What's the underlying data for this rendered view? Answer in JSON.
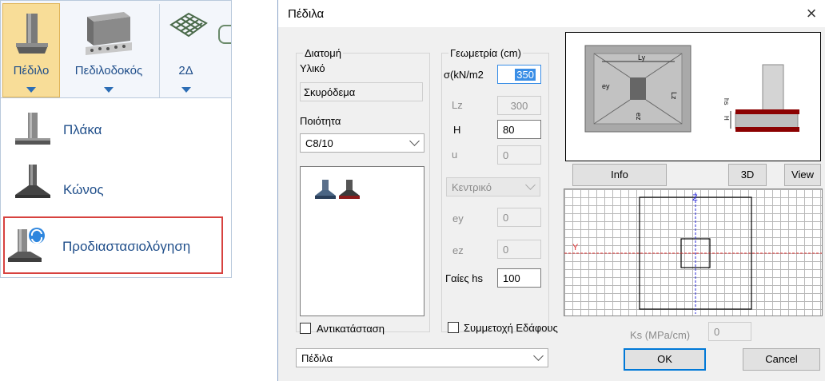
{
  "ribbon": {
    "buttons": [
      {
        "label": "Πέδιλο"
      },
      {
        "label": "Πεδιλοδοκός"
      },
      {
        "label": "2Δ"
      }
    ],
    "menu_items": [
      {
        "label": "Πλάκα"
      },
      {
        "label": "Κώνος"
      },
      {
        "label": "Προδιαστασιολόγηση"
      }
    ]
  },
  "dialog": {
    "title": "Πέδιλα",
    "close": "×",
    "section": {
      "title": "Διατομή",
      "material_label": "Υλικό",
      "material_value": "Σκυρόδεμα",
      "quality_label": "Ποιότητα",
      "quality_value": "C8/10"
    },
    "geometry": {
      "title": "Γεωμετρία (cm)",
      "sigma_label": "σ(kN/m2",
      "sigma_value": "350",
      "lz_label": "Lz",
      "lz_value": "300",
      "h_label": "H",
      "h_value": "80",
      "u_label": "u",
      "u_value": "0",
      "position_value": "Κεντρικό",
      "ey_label": "ey",
      "ey_value": "0",
      "ez_label": "ez",
      "ez_value": "0",
      "hs_label": "Γαίες hs",
      "hs_value": "100"
    },
    "preview_labels": {
      "ly": "Ly",
      "ey": "ey",
      "lz": "Lz",
      "ez": "ez",
      "h": "H",
      "hs": "hs"
    },
    "buttons": {
      "info": "Info",
      "three_d": "3D",
      "view": "View",
      "ok": "OK",
      "cancel": "Cancel"
    },
    "grid_axes": {
      "y": "Y",
      "z": "Z"
    },
    "replace_label": "Αντικατάσταση",
    "soil_label": "Συμμετοχή Εδάφους",
    "ks_label": "Ks (MPa/cm)",
    "ks_value": "0",
    "type_value": "Πέδιλα"
  },
  "colors": {
    "accent": "#0078d7",
    "ribbon_selected": "#f8dd98",
    "highlight_border": "#d7423f",
    "menu_text": "#1f4e8a",
    "soil_red": "#8b0000"
  }
}
